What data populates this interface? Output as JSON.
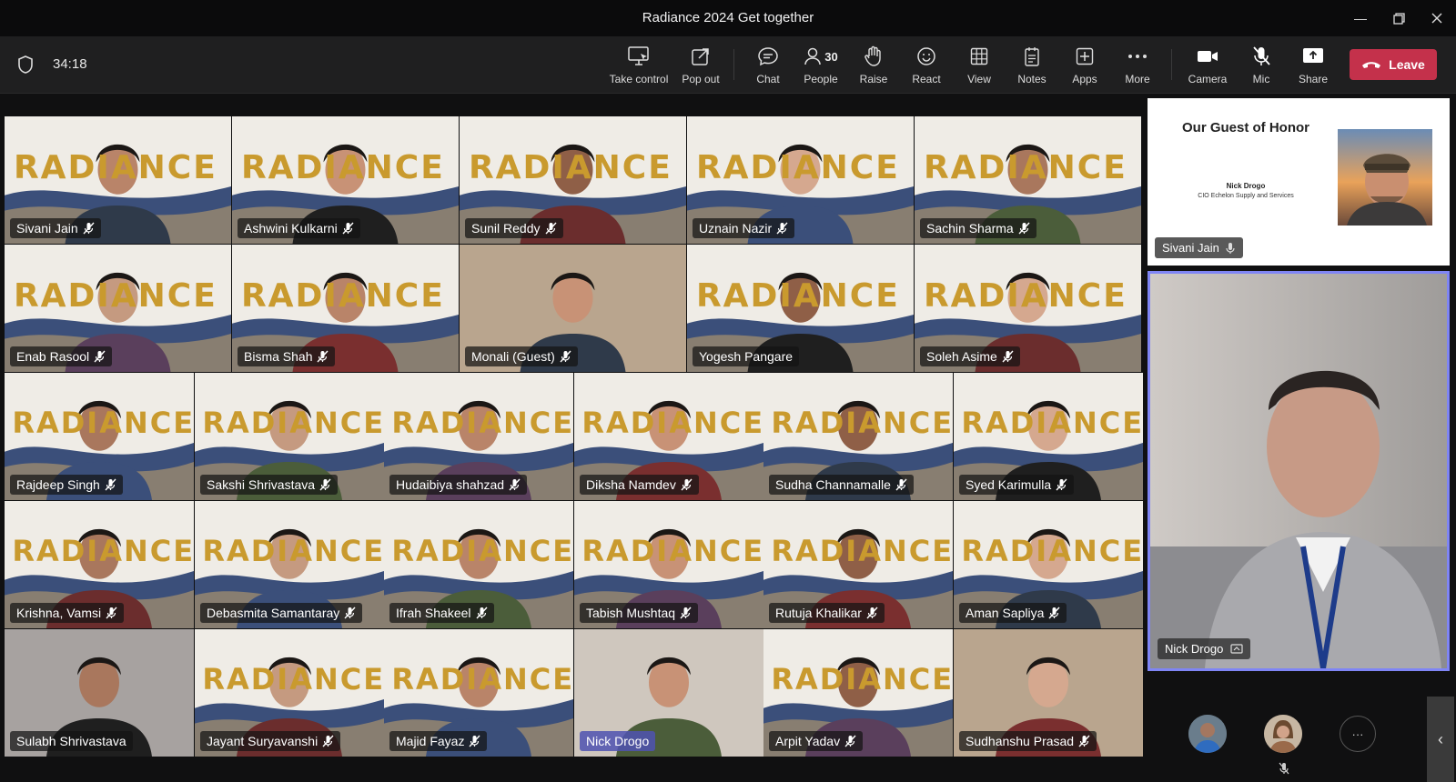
{
  "window": {
    "title": "Radiance 2024 Get together"
  },
  "toolbar": {
    "timer": "34:18",
    "take_control": "Take control",
    "pop_out": "Pop out",
    "chat": "Chat",
    "people": "People",
    "people_count": "30",
    "raise": "Raise",
    "react": "React",
    "view": "View",
    "notes": "Notes",
    "apps": "Apps",
    "more": "More",
    "camera": "Camera",
    "mic": "Mic",
    "share": "Share",
    "leave": "Leave"
  },
  "brand_word": "RADIANCE",
  "participants": [
    {
      "name": "Sivani Jain",
      "muted": true
    },
    {
      "name": "Ashwini Kulkarni",
      "muted": true
    },
    {
      "name": "Sunil Reddy",
      "muted": true
    },
    {
      "name": "Uznain Nazir",
      "muted": true
    },
    {
      "name": "Sachin Sharma",
      "muted": true
    },
    {
      "name": "Enab Rasool",
      "muted": true
    },
    {
      "name": "Bisma Shah",
      "muted": true
    },
    {
      "name": "Monali (Guest)",
      "muted": true
    },
    {
      "name": "Yogesh Pangare",
      "muted": false
    },
    {
      "name": "Soleh Asime",
      "muted": true
    },
    {
      "name": "Rajdeep Singh",
      "muted": true
    },
    {
      "name": "Sakshi Shrivastava",
      "muted": true
    },
    {
      "name": "Hudaibiya shahzad",
      "muted": true
    },
    {
      "name": "Diksha Namdev",
      "muted": true
    },
    {
      "name": "Sudha Channamalle",
      "muted": true
    },
    {
      "name": "Syed Karimulla",
      "muted": true
    },
    {
      "name": "Krishna, Vamsi",
      "muted": true
    },
    {
      "name": "Debasmita Samantaray",
      "muted": true
    },
    {
      "name": "Ifrah Shakeel",
      "muted": true
    },
    {
      "name": "Tabish Mushtaq",
      "muted": true
    },
    {
      "name": "Rutuja Khalikar",
      "muted": true
    },
    {
      "name": "Aman Sapliya",
      "muted": true
    },
    {
      "name": "Sulabh Shrivastava",
      "muted": false
    },
    {
      "name": "Jayant Suryavanshi",
      "muted": true
    },
    {
      "name": "Majid Fayaz",
      "muted": true
    },
    {
      "name": "Nick Drogo",
      "muted": false,
      "highlight": true
    },
    {
      "name": "Arpit Yadav",
      "muted": true
    },
    {
      "name": "Sudhanshu Prasad",
      "muted": true
    }
  ],
  "guest_slide": {
    "title": "Our Guest of Honor",
    "name": "Nick Drogo",
    "role": "CIO Echelon Supply and Services",
    "presenter": "Sivani Jain"
  },
  "spotlight": {
    "name": "Nick Drogo"
  },
  "overflow": {
    "more_label": "···"
  },
  "colors": {
    "leave": "#c4314b",
    "spotlight_border": "#7f85f5",
    "brand_gold": "#c99a2e",
    "wave_blue": "#3b4f7a"
  }
}
